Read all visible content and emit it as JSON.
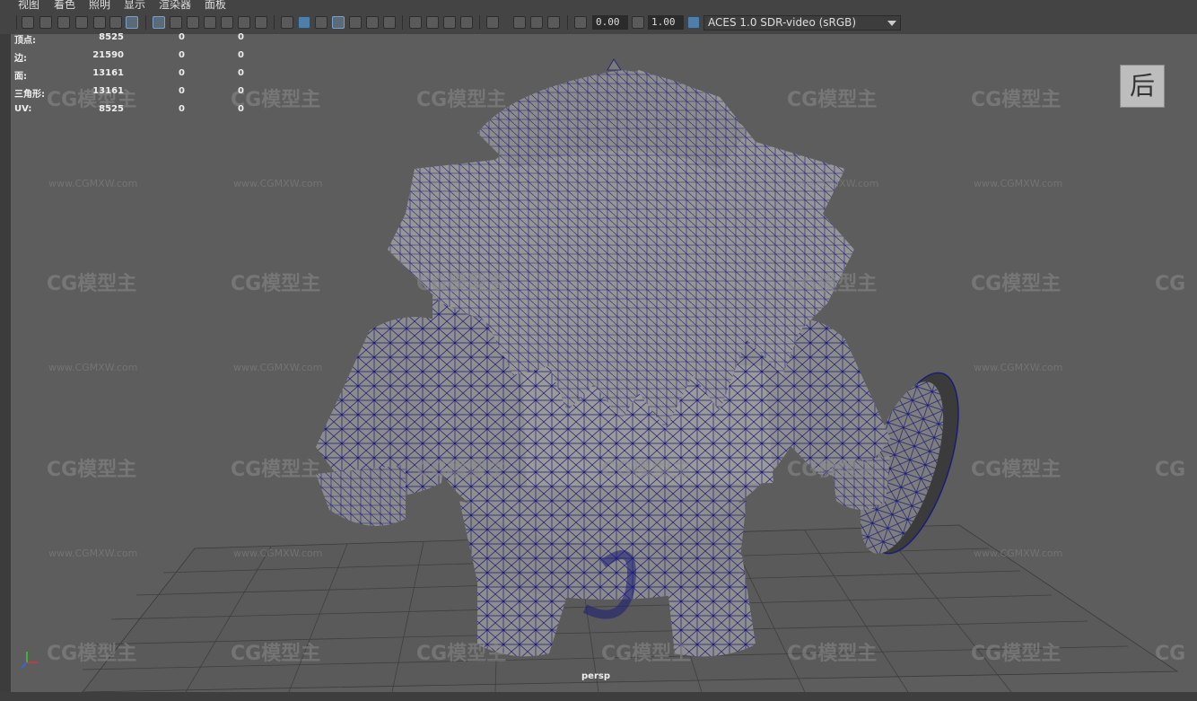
{
  "menu": [
    "视图",
    "着色",
    "照明",
    "显示",
    "渲染器",
    "面板"
  ],
  "toolbar": {
    "exposure_value": "0.00",
    "gamma_value": "1.00",
    "color_space": "ACES 1.0 SDR-video (sRGB)"
  },
  "hud": {
    "rows": [
      {
        "label": "顶点:",
        "values": [
          "8525",
          "0",
          "0"
        ]
      },
      {
        "label": "边:",
        "values": [
          "21590",
          "0",
          "0"
        ]
      },
      {
        "label": "面:",
        "values": [
          "13161",
          "0",
          "0"
        ]
      },
      {
        "label": "三角形:",
        "values": [
          "13161",
          "0",
          "0"
        ]
      },
      {
        "label": "UV:",
        "values": [
          "8525",
          "0",
          "0"
        ]
      }
    ]
  },
  "view_cube_label": "后",
  "camera_label": "persp",
  "watermark": {
    "logo": "CG模型主",
    "url": "www.CGMXW.com"
  },
  "colors": {
    "wire": "#1c1c78",
    "mesh": "#8e8e8e",
    "viewport_bg": "#5d5d5d",
    "accent": "#4f7fa9"
  }
}
